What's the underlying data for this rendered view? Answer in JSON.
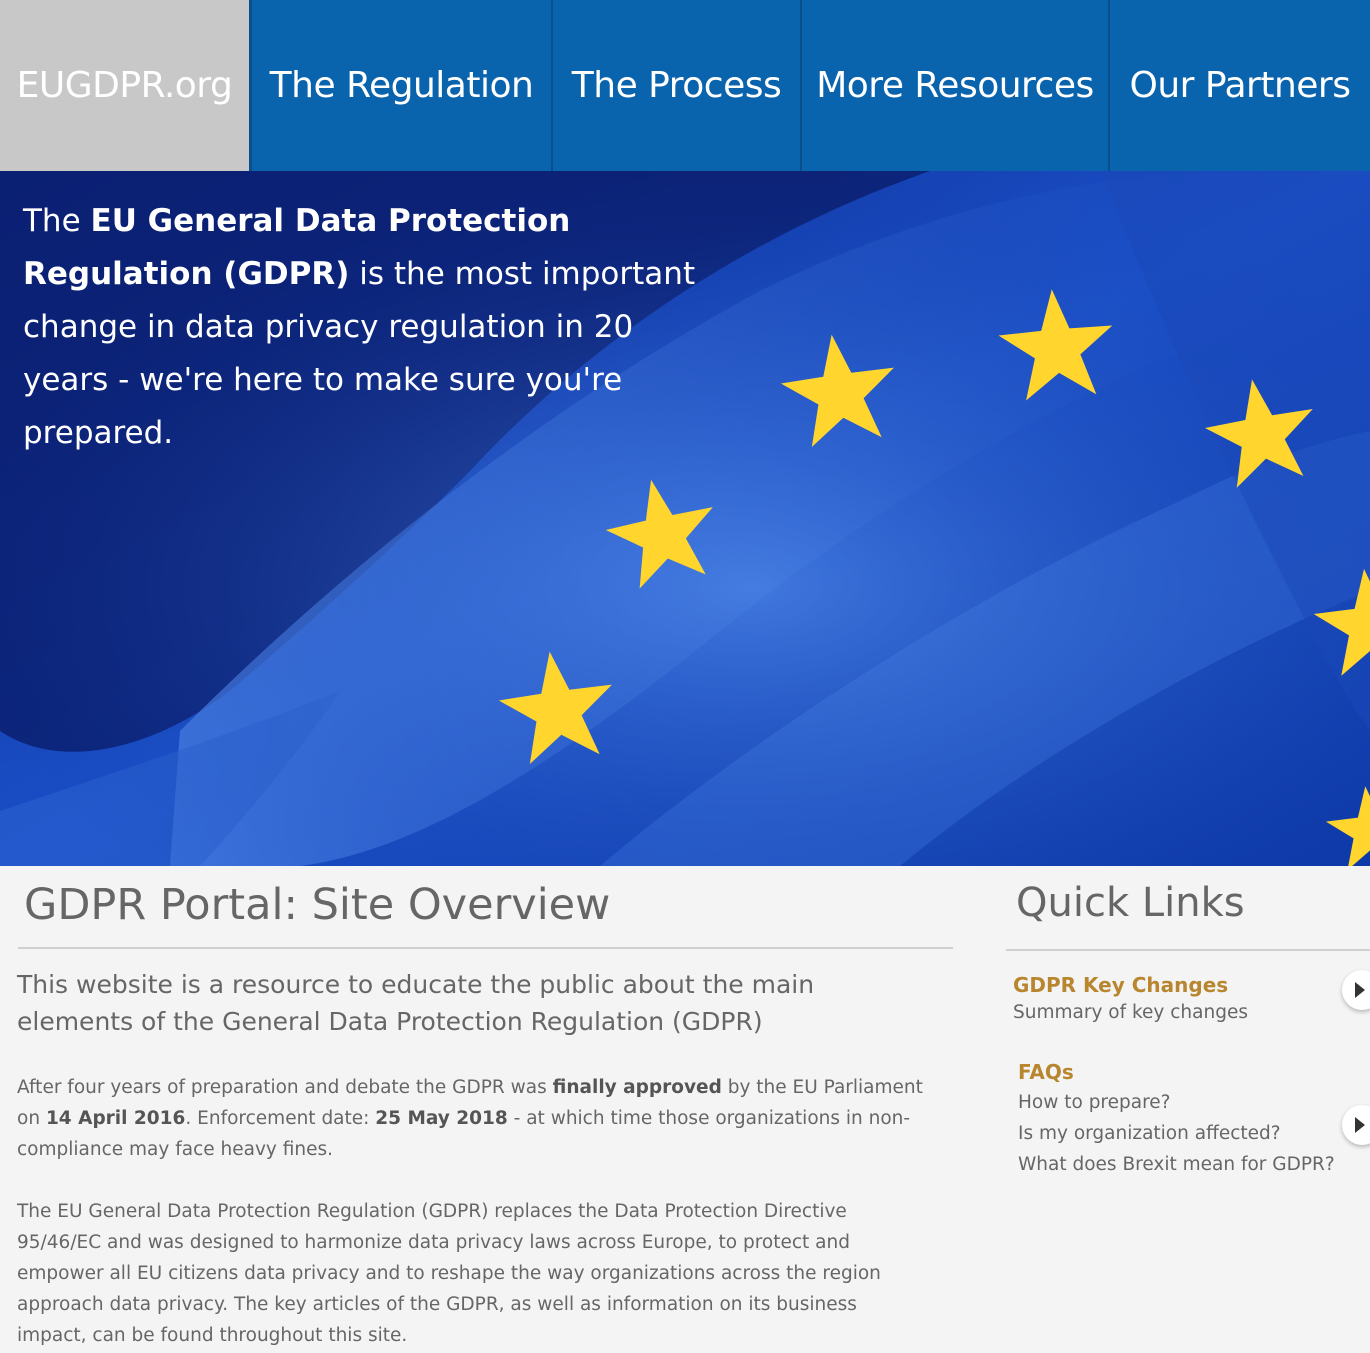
{
  "nav": {
    "brand": "EUGDPR.org",
    "items": [
      "The Regulation",
      "The Process",
      "More Resources",
      "Our Partners"
    ]
  },
  "hero": {
    "part1": "The ",
    "bold1": "EU General Data Protection Regulation (GDPR)",
    "part2": " is the most important change in data privacy regulation in 20 years - we're here to make sure you're prepared."
  },
  "main": {
    "title": "GDPR Portal: Site Overview",
    "lead": "This website is a resource to educate the public about the main elements of the General Data Protection Regulation (GDPR)",
    "p1": {
      "a": "After four years of preparation and debate the GDPR was ",
      "b": "finally approved",
      "c": " by the EU Parliament on ",
      "d": "14 April 2016",
      "e": ". Enforcement date: ",
      "f": "25 May 2018",
      "g": " - at which time those organizations in non-compliance may face heavy fines."
    },
    "p2": "The EU General Data Protection Regulation (GDPR) replaces the Data Protection Directive 95/46/EC and was designed to harmonize data privacy laws across Europe, to protect and empower all EU citizens data privacy and to reshape the way organizations across the region approach data privacy. The key articles of the GDPR, as well as information on its business impact, can be found throughout this site."
  },
  "quick_links": {
    "title": "Quick Links",
    "group1": {
      "heading": "GDPR Key Changes",
      "items": [
        "Summary of key changes"
      ]
    },
    "group2": {
      "heading": "FAQs",
      "items": [
        "How to prepare?",
        "Is my organization affected?",
        "What does Brexit mean for GDPR?"
      ]
    }
  },
  "colors": {
    "nav_blue": "#0a63ad",
    "brand_gray": "#c8c8c8",
    "link_gold": "#b8862e",
    "text_gray": "#666666"
  }
}
